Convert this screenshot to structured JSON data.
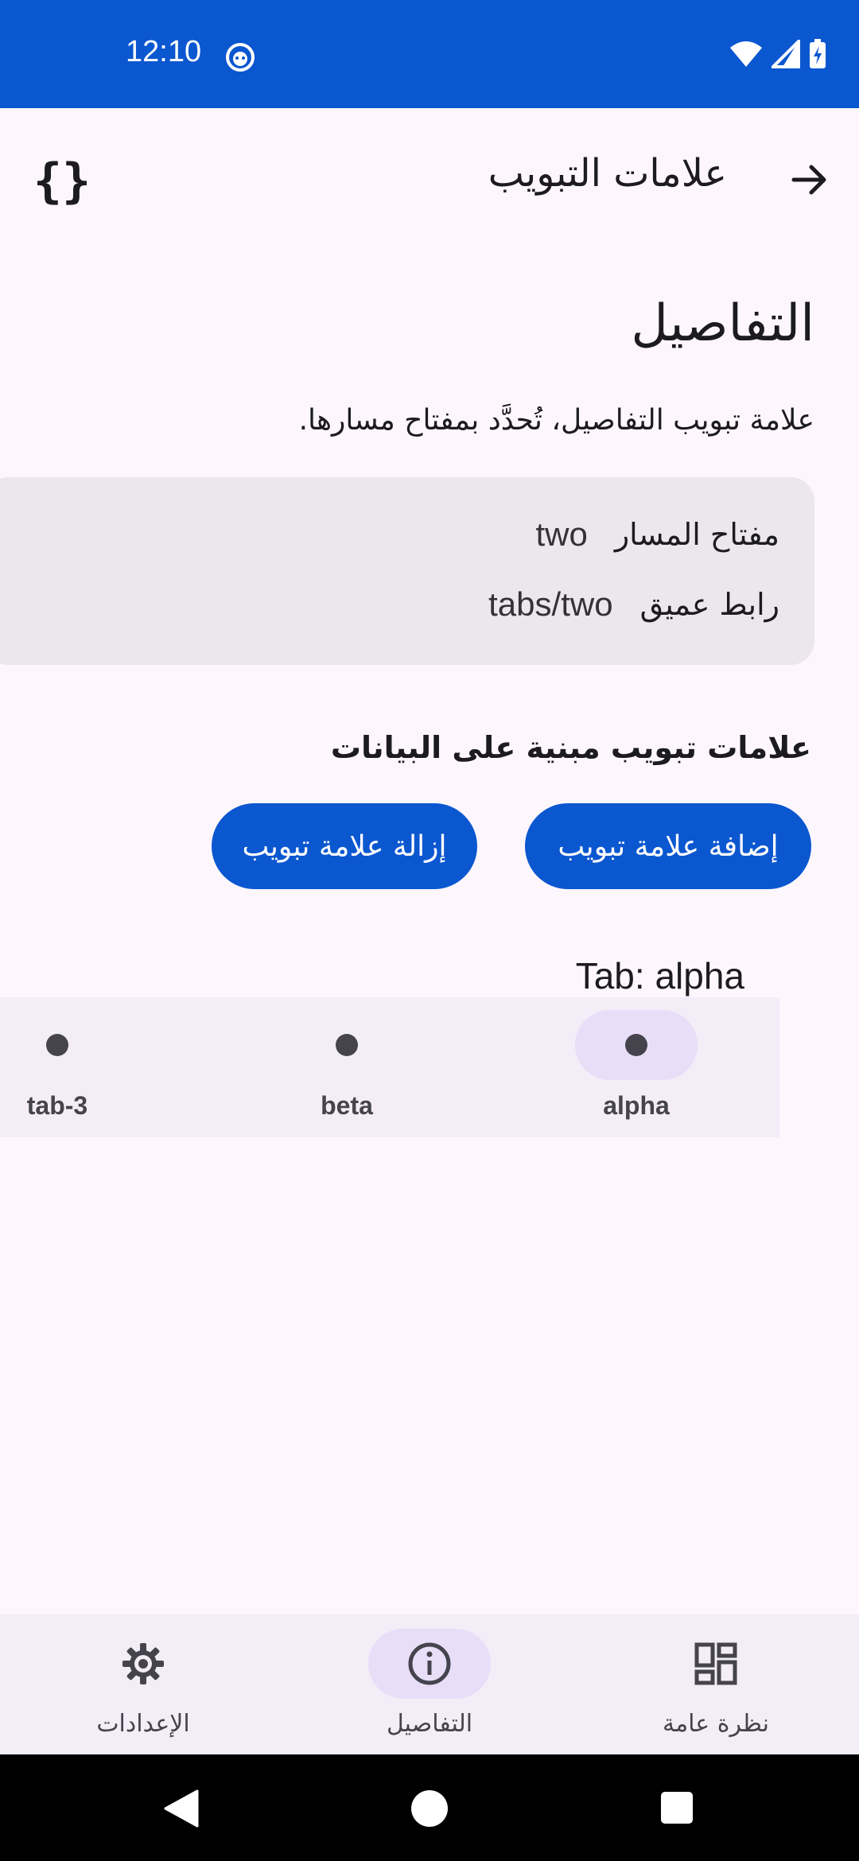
{
  "status": {
    "time": "12:10"
  },
  "app_bar": {
    "title": "علامات التبويب"
  },
  "details": {
    "title": "التفاصيل",
    "description": "علامة تبويب التفاصيل، تُحدَّد بمفتاح مسارها.",
    "route_key_label": "مفتاح المسار",
    "route_key_value": "two",
    "deep_link_label": "رابط عميق",
    "deep_link_value": "tabs/two"
  },
  "data_tabs": {
    "heading": "علامات تبويب مبنية على البيانات",
    "add_label": "إضافة علامة تبويب",
    "remove_label": "إزالة علامة تبويب",
    "current_tab": "Tab: alpha",
    "tabs": [
      "alpha",
      "beta",
      "tab-3"
    ]
  },
  "bottom_nav": {
    "items": [
      "نظرة عامة",
      "التفاصيل",
      "الإعدادات"
    ]
  },
  "colors": {
    "primary": "#0b57d0",
    "selected_pill": "#e8def8",
    "surface": "#fdf7fd"
  }
}
